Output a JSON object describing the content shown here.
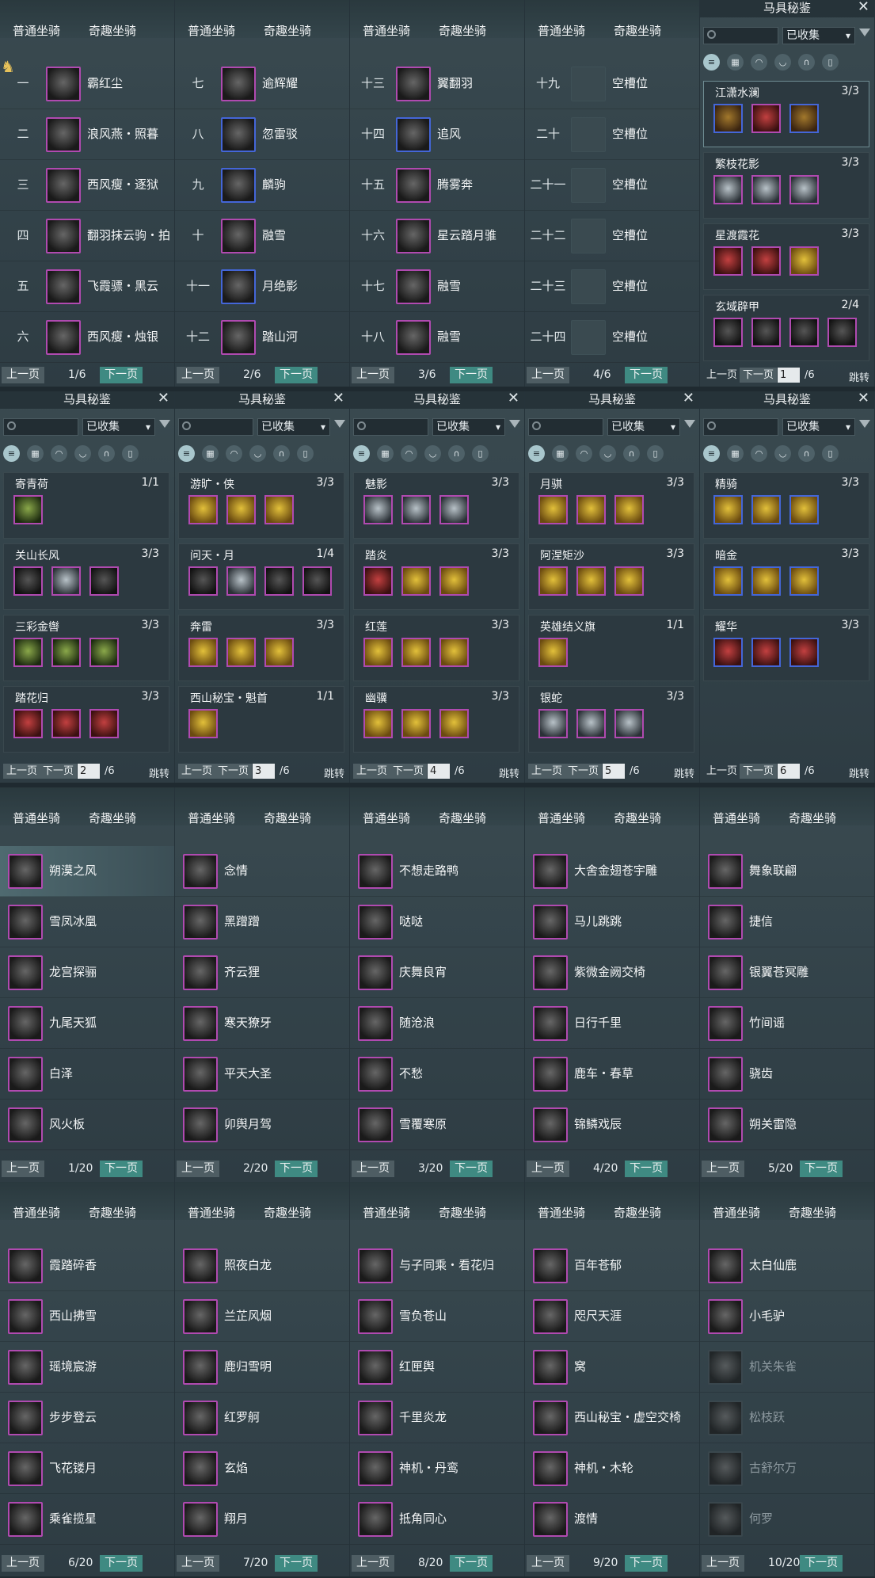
{
  "tabs": {
    "normal": "普通坐骑",
    "fun": "奇趣坐骑"
  },
  "pager": {
    "prev": "上一页",
    "next": "下一页"
  },
  "catalog": {
    "title": "马具秘鉴",
    "close": "✕",
    "filter_value": "已收集",
    "of_label": "/6",
    "jump": "跳转",
    "category_icons": [
      "list-icon",
      "grid-icon",
      "saddle-icon",
      "harness-icon",
      "horseshoe-icon",
      "scroll-icon"
    ]
  },
  "row1": [
    {
      "page": "1/6",
      "slots": [
        [
          "一",
          "霸红尘",
          ""
        ],
        [
          "二",
          "浪风燕・照暮",
          ""
        ],
        [
          "三",
          "西风瘦・逐狱",
          ""
        ],
        [
          "四",
          "翻羽抹云驹・拍",
          ""
        ],
        [
          "五",
          "飞霞骠・黑云",
          ""
        ],
        [
          "六",
          "西风瘦・烛银",
          ""
        ]
      ]
    },
    {
      "page": "2/6",
      "slots": [
        [
          "七",
          "逾辉耀",
          ""
        ],
        [
          "八",
          "忽雷驳",
          "blue"
        ],
        [
          "九",
          "麟驹",
          "blue"
        ],
        [
          "十",
          "融雪",
          ""
        ],
        [
          "十一",
          "月绝影",
          "blue"
        ],
        [
          "十二",
          "踏山河",
          ""
        ]
      ]
    },
    {
      "page": "3/6",
      "slots": [
        [
          "十三",
          "翼翻羽",
          ""
        ],
        [
          "十四",
          "追风",
          "blue"
        ],
        [
          "十五",
          "腾雾奔",
          ""
        ],
        [
          "十六",
          "星云踏月骓",
          ""
        ],
        [
          "十七",
          "融雪",
          ""
        ],
        [
          "十八",
          "融雪",
          ""
        ]
      ]
    },
    {
      "page": "4/6",
      "slots": [
        [
          "十九",
          "空槽位",
          "empty"
        ],
        [
          "二十",
          "空槽位",
          "empty"
        ],
        [
          "二十一",
          "空槽位",
          "empty"
        ],
        [
          "二十二",
          "空槽位",
          "empty"
        ],
        [
          "二十三",
          "空槽位",
          "empty"
        ],
        [
          "二十四",
          "空槽位",
          "empty"
        ]
      ]
    }
  ],
  "catalog_pages": [
    {
      "page": "1",
      "cards": [
        {
          "name": "江潇水澜",
          "count": "3/3",
          "items": [
            "blue",
            "r",
            "blue"
          ]
        },
        {
          "name": "繁枝花影",
          "count": "3/3",
          "items": [
            "s",
            "s",
            "s"
          ]
        },
        {
          "name": "星渡霞花",
          "count": "3/3",
          "items": [
            "r",
            "r",
            "y"
          ]
        },
        {
          "name": "玄域辟甲",
          "count": "2/4",
          "items": [
            "d",
            "d",
            "d",
            "d"
          ]
        }
      ]
    },
    {
      "page": "2",
      "cards": [
        {
          "name": "寄青荷",
          "count": "1/1",
          "items": [
            "g"
          ]
        },
        {
          "name": "关山长风",
          "count": "3/3",
          "items": [
            "d",
            "s",
            "d"
          ]
        },
        {
          "name": "三彩金辔",
          "count": "3/3",
          "items": [
            "g",
            "g",
            "g"
          ]
        },
        {
          "name": "踏花归",
          "count": "3/3",
          "items": [
            "r",
            "r",
            "r"
          ]
        }
      ]
    },
    {
      "page": "3",
      "cards": [
        {
          "name": "游旷・侠",
          "count": "3/3",
          "items": [
            "y",
            "y",
            "y"
          ]
        },
        {
          "name": "问天・月",
          "count": "1/4",
          "items": [
            "d",
            "s",
            "d",
            "d"
          ]
        },
        {
          "name": "奔雷",
          "count": "3/3",
          "items": [
            "y",
            "y",
            "y"
          ]
        },
        {
          "name": "西山秘宝・魁首",
          "count": "1/1",
          "items": [
            "y"
          ]
        }
      ]
    },
    {
      "page": "4",
      "cards": [
        {
          "name": "魅影",
          "count": "3/3",
          "items": [
            "s",
            "s",
            "s"
          ]
        },
        {
          "name": "踏炎",
          "count": "3/3",
          "items": [
            "r",
            "y",
            "y"
          ]
        },
        {
          "name": "红莲",
          "count": "3/3",
          "items": [
            "y",
            "y",
            "y"
          ]
        },
        {
          "name": "幽骥",
          "count": "3/3",
          "items": [
            "y",
            "y",
            "y"
          ]
        }
      ]
    },
    {
      "page": "5",
      "cards": [
        {
          "name": "月骐",
          "count": "3/3",
          "items": [
            "y",
            "y",
            "y"
          ]
        },
        {
          "name": "阿涅矩沙",
          "count": "3/3",
          "items": [
            "y",
            "y",
            "y"
          ]
        },
        {
          "name": "英雄结义旗",
          "count": "1/1",
          "items": [
            "y"
          ]
        },
        {
          "name": "银蛇",
          "count": "3/3",
          "items": [
            "s",
            "s",
            "s"
          ]
        }
      ]
    },
    {
      "page": "6",
      "cards": [
        {
          "name": "精骑",
          "count": "3/3",
          "items": [
            "y",
            "y",
            "y"
          ]
        },
        {
          "name": "暗金",
          "count": "3/3",
          "items": [
            "y",
            "y",
            "y"
          ]
        },
        {
          "name": "耀华",
          "count": "3/3",
          "items": [
            "r",
            "r",
            "r"
          ]
        }
      ]
    }
  ],
  "fun_pages": [
    {
      "page": "1/20",
      "names": [
        "朔漠之风",
        "雪凤冰凰",
        "龙宫探骊",
        "九尾天狐",
        "白泽",
        "风火板"
      ]
    },
    {
      "page": "2/20",
      "names": [
        "念情",
        "黑蹭蹭",
        "齐云狸",
        "寒天獠牙",
        "平天大圣",
        "卯舆月驾"
      ]
    },
    {
      "page": "3/20",
      "names": [
        "不想走路鸭",
        "哒哒",
        "庆舞良宵",
        "随沧浪",
        "不愁",
        "雪覆寒原"
      ]
    },
    {
      "page": "4/20",
      "names": [
        "大舍金翅苍宇雕",
        "马儿跳跳",
        "紫微金阙交椅",
        "日行千里",
        "鹿车・春草",
        "锦鳞戏辰"
      ]
    },
    {
      "page": "5/20",
      "names": [
        "舞象联翩",
        "捷信",
        "银翼苍冥雕",
        "竹间谣",
        "骁齿",
        "朔关雷隐"
      ]
    },
    {
      "page": "6/20",
      "names": [
        "霞踏碎香",
        "西山拂雪",
        "瑶境宸游",
        "步步登云",
        "飞花镂月",
        "乘雀揽星"
      ]
    },
    {
      "page": "7/20",
      "names": [
        "照夜白龙",
        "兰芷风烟",
        "鹿归雪明",
        "红罗舸",
        "玄焰",
        "翔月"
      ]
    },
    {
      "page": "8/20",
      "names": [
        "与子同乘・看花归",
        "雪负苍山",
        "红匣舆",
        "千里炎龙",
        "神机・丹鸾",
        "抵角同心"
      ]
    },
    {
      "page": "9/20",
      "names": [
        "百年苍郁",
        "咫尺天涯",
        "窝",
        "西山秘宝・虚空交椅",
        "神机・木轮",
        "渡情"
      ]
    },
    {
      "page": "10/20",
      "names": [
        "太白仙鹿",
        "小毛驴",
        "机关朱雀",
        "松枝跃",
        "古舒尔万",
        "何罗"
      ]
    }
  ]
}
